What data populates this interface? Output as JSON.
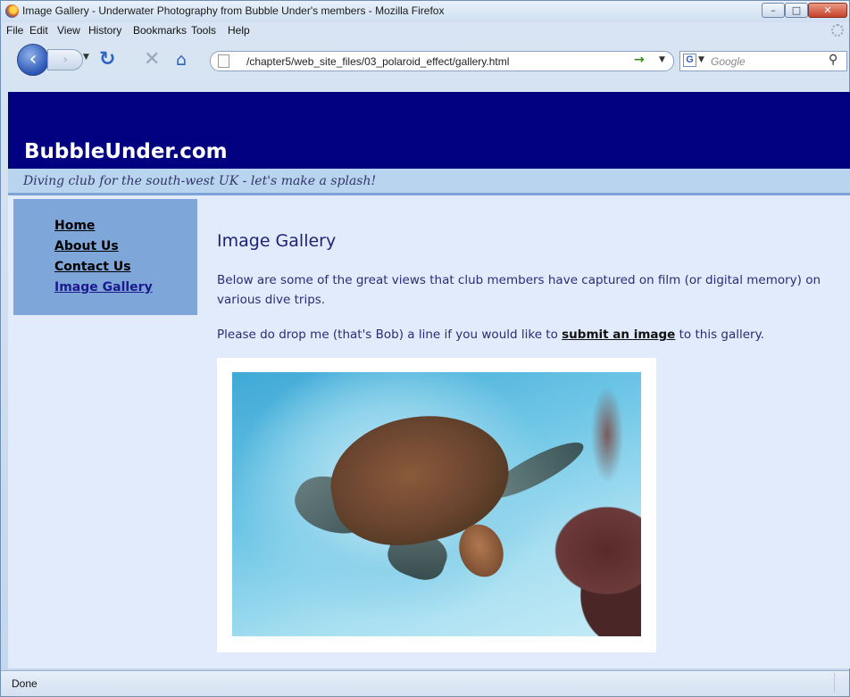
{
  "window": {
    "title": "Image Gallery - Underwater Photography from Bubble Under's members - Mozilla Firefox",
    "minimize": "–",
    "maximize": "□",
    "close": "✕"
  },
  "menu": [
    "File",
    "Edit",
    "View",
    "History",
    "Bookmarks",
    "Tools",
    "Help"
  ],
  "navbar": {
    "back_icon": "arrow-left-icon",
    "url": "/chapter5/web_site_files/03_polaroid_effect/gallery.html",
    "search_placeholder": "Google",
    "search_engine": "G"
  },
  "site": {
    "title": "BubbleUnder.com",
    "tagline": "Diving club for the south-west UK - let's make a splash!"
  },
  "sidenav": [
    {
      "label": "Home"
    },
    {
      "label": "About Us"
    },
    {
      "label": "Contact Us"
    },
    {
      "label": "Image Gallery",
      "current": true
    }
  ],
  "main": {
    "heading": "Image Gallery",
    "intro": "Below are some of the great views that club members have captured on film (or digital memory) on various dive trips.",
    "submit_prefix": "Please do drop me (that's Bob) a line if you would like to ",
    "submit_link": "submit an image",
    "submit_suffix": " to this gallery."
  },
  "status": {
    "text": "Done"
  },
  "colors": {
    "header_bg": "#000080",
    "tagline_band": "#b9d4ef",
    "sidenav_bg": "#7ea6d9",
    "content_bg": "#e1ebfb"
  }
}
